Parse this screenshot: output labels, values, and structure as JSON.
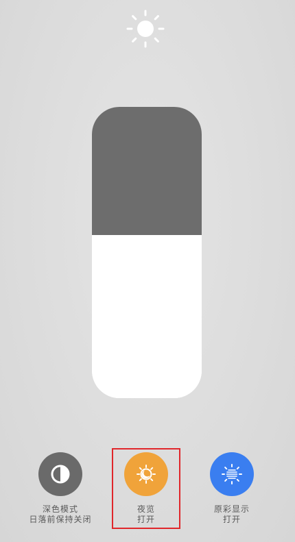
{
  "brightness": {
    "level": 0.56,
    "icon": "sun-icon"
  },
  "controls": [
    {
      "id": "dark-mode",
      "icon": "dark-mode-icon",
      "title": "深色模式",
      "subtitle": "日落前保持关闭",
      "color": "#6a6a6a",
      "active": false
    },
    {
      "id": "night-shift",
      "icon": "night-shift-icon",
      "title": "夜览",
      "subtitle": "打开",
      "color": "#f0a33a",
      "active": true
    },
    {
      "id": "true-tone",
      "icon": "true-tone-icon",
      "title": "原彩显示",
      "subtitle": "打开",
      "color": "#3a7ef0",
      "active": true
    }
  ],
  "highlight_color": "#e0262a"
}
